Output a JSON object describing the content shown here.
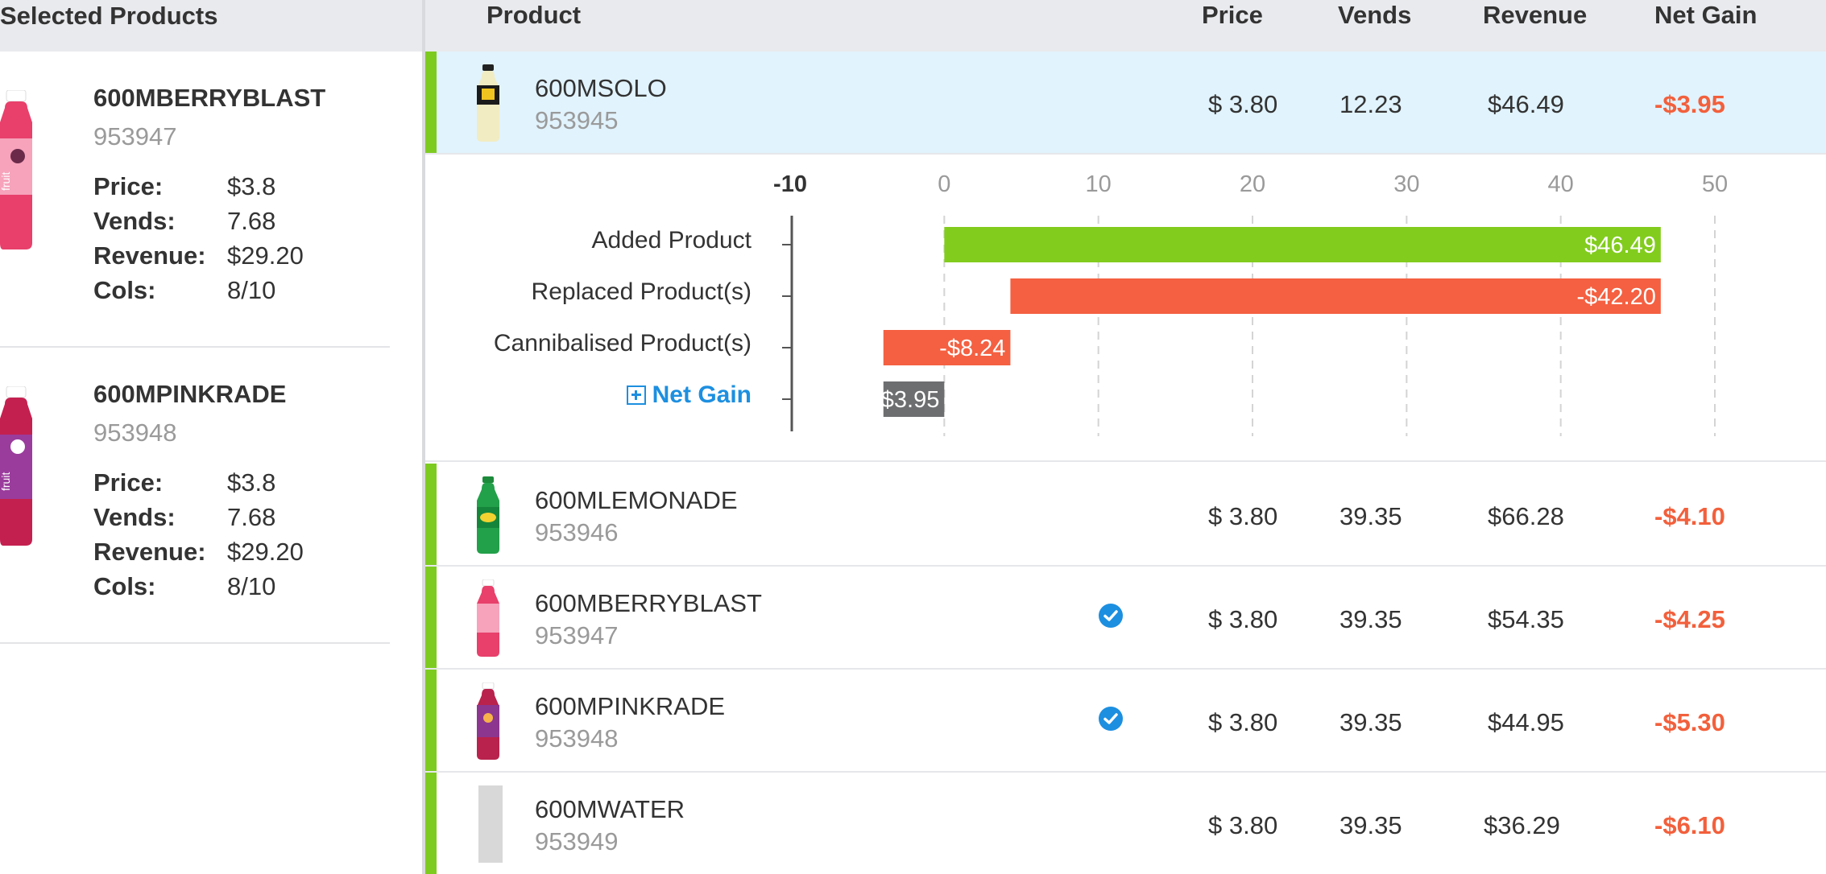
{
  "left_panel": {
    "title": "Selected Products",
    "cards": [
      {
        "name": "600MBERRYBLAST",
        "code": "953947",
        "stats": [
          {
            "label": "Price:",
            "value": "$3.8"
          },
          {
            "label": "Vends:",
            "value": "7.68"
          },
          {
            "label": "Revenue:",
            "value": "$29.20"
          },
          {
            "label": "Cols:",
            "value": "8/10"
          }
        ],
        "bottle_color": "#e8406b",
        "label_color": "#f6a3bb",
        "brand_text": "fruit"
      },
      {
        "name": "600MPINKRADE",
        "code": "953948",
        "stats": [
          {
            "label": "Price:",
            "value": "$3.8"
          },
          {
            "label": "Vends:",
            "value": "7.68"
          },
          {
            "label": "Revenue:",
            "value": "$29.20"
          },
          {
            "label": "Cols:",
            "value": "8/10"
          }
        ],
        "bottle_color": "#c4204f",
        "label_color": "#9a3c9c",
        "brand_text": "fruit"
      }
    ]
  },
  "table": {
    "headers": {
      "product": "Product",
      "price": "Price",
      "vends": "Vends",
      "revenue": "Revenue",
      "net_gain": "Net Gain"
    },
    "rows": [
      {
        "name": "600MSOLO",
        "code": "953945",
        "price": "$ 3.80",
        "vends": "12.23",
        "revenue": "$46.49",
        "net_gain": "-$3.95",
        "selected": true,
        "checked": false,
        "bottle": "solo"
      },
      {
        "name": "600MLEMONADE",
        "code": "953946",
        "price": "$ 3.80",
        "vends": "39.35",
        "revenue": "$66.28",
        "net_gain": "-$4.10",
        "selected": false,
        "checked": false,
        "bottle": "sprite"
      },
      {
        "name": "600MBERRYBLAST",
        "code": "953947",
        "price": "$ 3.80",
        "vends": "39.35",
        "revenue": "$54.35",
        "net_gain": "-$4.25",
        "selected": false,
        "checked": true,
        "bottle": "berry"
      },
      {
        "name": "600MPINKRADE",
        "code": "953948",
        "price": "$ 3.80",
        "vends": "39.35",
        "revenue": "$44.95",
        "net_gain": "-$5.30",
        "selected": false,
        "checked": true,
        "bottle": "pink"
      },
      {
        "name": "600MWATER",
        "code": "953949",
        "price": "$ 3.80",
        "vends": "39.35",
        "revenue": "$36.29",
        "net_gain": "-$6.10",
        "selected": false,
        "checked": false,
        "bottle": "water"
      }
    ]
  },
  "colors": {
    "accent_green": "#7ecb20",
    "bar_green": "#82cc1e",
    "bar_red": "#f46041",
    "bar_gray": "#6d6e70",
    "negative_text": "#f2603c",
    "link_blue": "#1d8fe0",
    "selected_row_bg": "#e1f3fd",
    "header_bg": "#e9eaed"
  },
  "chart_data": {
    "type": "bar",
    "orientation": "horizontal",
    "subtype": "waterfall",
    "categories": [
      "Added Product",
      "Replaced Product(s)",
      "Cannibalised Product(s)",
      "Net Gain"
    ],
    "bars": [
      {
        "category": "Added Product",
        "start": 0,
        "end": 46.49,
        "label": "$46.49",
        "color": "green"
      },
      {
        "category": "Replaced Product(s)",
        "start": 46.49,
        "end": 4.29,
        "label": "-$42.20",
        "color": "red"
      },
      {
        "category": "Cannibalised Product(s)",
        "start": 4.29,
        "end": -3.95,
        "label": "-$8.24",
        "color": "red"
      },
      {
        "category": "Net Gain",
        "start": 0,
        "end": -3.95,
        "label": "-$3.95",
        "color": "gray"
      }
    ],
    "xlim": [
      -10,
      50
    ],
    "ticks": [
      "-10",
      "0",
      "10",
      "20",
      "30",
      "40",
      "50"
    ],
    "tick_values": [
      -10,
      0,
      10,
      20,
      30,
      40,
      50
    ],
    "grid": "dashed vertical",
    "net_gain_expand_icon": "plus-square-icon"
  }
}
